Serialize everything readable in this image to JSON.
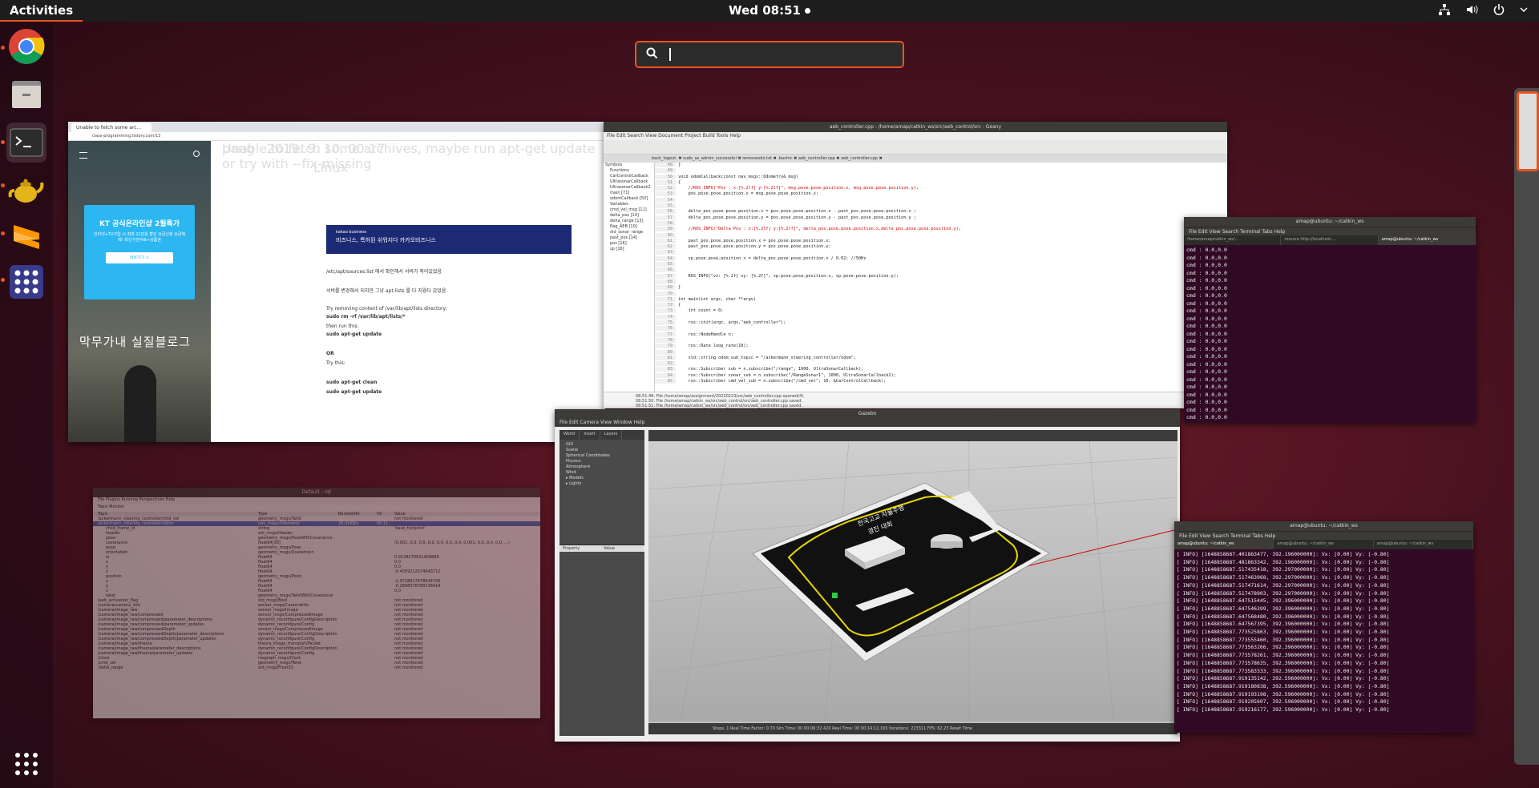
{
  "topbar": {
    "activities": "Activities",
    "clock": "Wed 08:51"
  },
  "dock": {
    "apps": [
      "chrome-icon",
      "files-icon",
      "terminal-icon",
      "teapot-icon",
      "sublime-icon",
      "apps-grid-icon"
    ],
    "show_apps": "show-apps-icon"
  },
  "search": {
    "placeholder": "",
    "value": ""
  },
  "browser": {
    "tab_title": "Unable to fetch some arc...",
    "url": "class-programming.tistory.com/13",
    "ad_heading": "KT 공식온라인샵 2월특가",
    "ad_sub": "인터넷+TV가입 시 최대 22만원 할인 요금신청 요금혜택! 최신가전무료+상품권",
    "ad_button": "바로가기 >",
    "blog_title": "막무가내 실질블로그",
    "category": "Linux",
    "post_title": "Unable to fetch some archives, maybe run apt-get update or try with --fix-missing",
    "meta": "pang · 2019. 9. 10. 00:17",
    "banner_brand": "kakao business",
    "banner_text": "비즈니스, 특허된 쉬워지다 카카오비즈니스",
    "lines": [
      "/etc/apt/sources.list 에서 확인해서 서버가 죽어있었음",
      "서버를 변경해서 되지만 그냥 apt.lists 를 다 지웠다 갔었음",
      "Try removing content of /var/lib/apt/lists directory:",
      "sudo rm -rf /var/lib/apt/lists/*",
      "then run this:",
      "sudo apt-get update",
      "OR",
      "Try this:",
      "sudo apt-get clean",
      "sudo apt-get update"
    ]
  },
  "geany": {
    "title": "aeb_controller.cpp - /home/amap/catkin_ws/src/aeb_control/src - Geany",
    "menu": "File  Edit  Search  View  Document  Project  Build  Tools  Help",
    "tabs": "back_logout.  ✖  sudo_as_admin_successful  ✖  removeodo.txt  ✖  .bashrc  ✖  aeb_controller.cpp  ✖  aeb_controller.cpp  ✖",
    "side_items": [
      "Symbols",
      "Functions",
      "CarControlCallback",
      "UltrasonarCallback",
      "UltrasonarCallback2",
      "main [71]",
      "odomCallback [50]",
      "Variables",
      "cmd_vel_msg [11]",
      "delta_pos [14]",
      "delta_range [13]",
      "flag_AEB [10]",
      "old_sonar_range",
      "past_pos [14]",
      "pos [16]",
      "sp [16]"
    ],
    "code": [
      [
        "48",
        "}"
      ],
      [
        "49",
        ""
      ],
      [
        "50",
        "void odomCallback(const nav_msgs::Odometry& msg)"
      ],
      [
        "51",
        "{"
      ],
      [
        "52",
        "    //ROS_INFO(\"Pos : x:[%.2lf] y:[%.2lf]\", msg.pose.pose.position.x, msg.pose.pose.position.y);"
      ],
      [
        "53",
        "    pos.pose.pose.position.x = msg.pose.pose.position.x;"
      ],
      [
        "54",
        ""
      ],
      [
        "55",
        ""
      ],
      [
        "56",
        "    delta_pos.pose.pose.position.x = pos.pose.pose.position.x - past_pos.pose.pose.position.x ;"
      ],
      [
        "57",
        "    delta_pos.pose.pose.position.y = pos.pose.pose.position.y - past_pos.pose.pose.position.y ;"
      ],
      [
        "58",
        ""
      ],
      [
        "59",
        "    //ROS_INFO(\"Delta Pos : x:[%.2lf] y:[%.2lf]\", delta_pos.pose.pose.position.x,delta_pos.pose.pose.position.y);"
      ],
      [
        "60",
        ""
      ],
      [
        "61",
        "    past_pos.pose.pose.position.x = pos.pose.pose.position.x;"
      ],
      [
        "62",
        "    past_pos.pose.pose.position.y = pos.pose.pose.position.y;"
      ],
      [
        "63",
        ""
      ],
      [
        "64",
        "    sp.pose.pose.position.x = delta_pos.pose.pose.position.x / 0.02; //50Hz"
      ],
      [
        "65",
        ""
      ],
      [
        "66",
        ""
      ],
      [
        "67",
        "    ROS_INFO(\"vx: [%.2f] vy: [%.2f]\", sp.pose.pose.position.x, sp.pose.pose.position.y);"
      ],
      [
        "68",
        ""
      ],
      [
        "69",
        "}"
      ],
      [
        "70",
        ""
      ],
      [
        "71",
        "int main(int argc, char **argv)"
      ],
      [
        "72",
        "{"
      ],
      [
        "73",
        "    int count = 0;"
      ],
      [
        "74",
        ""
      ],
      [
        "75",
        "    ros::init(argc, argv,\"aeb_controller\");"
      ],
      [
        "76",
        ""
      ],
      [
        "77",
        "    ros::NodeHandle n;"
      ],
      [
        "78",
        ""
      ],
      [
        "79",
        "    ros::Rate loop_rate(10);"
      ],
      [
        "80",
        ""
      ],
      [
        "81",
        "    std::string odom_sub_topic = \"/ackermann_steering_controller/odom\";"
      ],
      [
        "82",
        ""
      ],
      [
        "83",
        "    ros::Subscriber sub = n.subscribe(\"/range\", 1000, UltraSonarCallback);"
      ],
      [
        "84",
        "    ros::Subscriber sonar_sub = n.subscribe(\"/RangeSonar1\", 1000, UltraSonarCallback2);"
      ],
      [
        "85",
        "    ros::Subscriber cmd_vel_sub = n.subscribe(\"/cmd_vel\", 10, &CarControlCallback);"
      ]
    ],
    "status_lines": [
      "08:51:46: File /home/amap/assignment/20220223/src/aeb_controller.cpp opened(4).",
      "08:51:50: File /home/amap/catkin_ws/src/aeb_control/src/aeb_controller.cpp saved.",
      "08:51:51: File /home/amap/catkin_ws/src/aeb_control/src/aeb_controller.cpp saved."
    ],
    "status_label": "Status",
    "compiler_label": "Compiler"
  },
  "term1": {
    "title": "amap@ubuntu: ~/catkin_ws",
    "menu": "File  Edit  View  Search  Terminal  Tabs  Help",
    "tabs": [
      "/home/amap/catkin_ws/...",
      "roscore http://localhost:...",
      "amap@ubuntu: ~/catkin_ws"
    ],
    "line": "cmd : 0.0,0.0",
    "count": 26
  },
  "term2": {
    "title": "amap@ubuntu: ~/catkin_ws",
    "menu": "File  Edit  View  Search  Terminal  Tabs  Help",
    "tabs": [
      "amap@ubuntu: ~/catkin_ws",
      "amap@ubuntu: ~/catkin_ws",
      "amap@ubuntu: ~/catkin_ws"
    ],
    "lines": [
      "[ INFO] [1648858687.401863477, 392.196000000]: Vx: [0.00] Vy: [-0.80]",
      "[ INFO] [1648858687.481863342, 392.196000000]: Vx: [0.00] Vy: [-0.80]",
      "[ INFO] [1648858687.517435418, 392.297000000]: Vx: [0.00] Vy: [-0.80]",
      "[ INFO] [1648858687.517463968, 392.297000000]: Vx: [0.00] Vy: [-0.80]",
      "[ INFO] [1648858687.517471614, 392.297000000]: Vx: [0.00] Vy: [-0.80]",
      "[ INFO] [1648858687.517478903, 392.297000000]: Vx: [0.00] Vy: [-0.80]",
      "[ INFO] [1648858687.647515445, 392.396000000]: Vx: [0.00] Vy: [-0.80]",
      "[ INFO] [1648858687.647546399, 392.396000000]: Vx: [0.00] Vy: [-0.80]",
      "[ INFO] [1648858687.647568480, 392.396000000]: Vx: [0.00] Vy: [-0.80]",
      "[ INFO] [1648858687.647567395, 392.396000000]: Vx: [0.00] Vy: [-0.80]",
      "[ INFO] [1648858687.773525863, 392.396000000]: Vx: [0.00] Vy: [-0.80]",
      "[ INFO] [1648858687.773555460, 392.396000000]: Vx: [0.00] Vy: [-0.80]",
      "[ INFO] [1648858687.773563266, 392.396000000]: Vx: [0.00] Vy: [-0.80]",
      "[ INFO] [1648858687.773578261, 392.396000000]: Vx: [0.00] Vy: [-0.80]",
      "[ INFO] [1648858687.773578635, 392.396000000]: Vx: [0.00] Vy: [-0.80]",
      "[ INFO] [1648858687.773583333, 392.396000000]: Vx: [0.00] Vy: [-0.80]",
      "[ INFO] [1648858687.919135142, 392.596000000]: Vx: [0.00] Vy: [-0.80]",
      "[ INFO] [1648858687.919180838, 392.596000000]: Vx: [0.00] Vy: [-0.80]",
      "[ INFO] [1648858687.919193198, 392.596000000]: Vx: [0.00] Vy: [-0.80]",
      "[ INFO] [1648858687.919205607, 392.596000000]: Vx: [0.00] Vy: [-0.80]",
      "[ INFO] [1648858687.919216177, 392.596000000]: Vx: [0.00] Vy: [-0.80]"
    ]
  },
  "gazebo": {
    "title": "Gazebo",
    "menu": "File  Edit  Camera  View  Window  Help",
    "tabs": [
      "World",
      "Insert",
      "Layers"
    ],
    "tree": [
      "GUI",
      "Scene",
      "Spherical Coordinates",
      "Physics",
      "Atmosphere",
      "Wind",
      "▸ Models",
      "▸ Lights"
    ],
    "prop_headers": [
      "Property",
      "Value"
    ],
    "track_text": [
      "전국고교 자율주행",
      "경진 대회"
    ],
    "bottom": "Steps: 1  Real Time Factor: 0.70   Sim Time: 00 00:06:32.420   Real Time: 00 00:14:12.165   Iterations: 223311   FPS: 62.23   Reset Time"
  },
  "rqt": {
    "title": "Default - rqt",
    "menu": "File  Plugins  Running  Perspectives  Help",
    "panel": "Topic Monitor",
    "headers": [
      "Topic",
      "Type",
      "Bandwidth",
      "Hz",
      "Value"
    ],
    "rows": [
      [
        "/ackermann_steering_controller/cmd_vel",
        "geometry_msgs/Twist",
        "",
        "",
        "not monitored"
      ],
      [
        "/ackermann_steering_controller/odom",
        "nav_msgs/Odometry",
        "28.01KB/s",
        "50.11",
        ""
      ],
      [
        "child_frame_id",
        "string",
        "",
        "",
        "'base_footprint'"
      ],
      [
        "header",
        "std_msgs/Header",
        "",
        "",
        ""
      ],
      [
        "pose",
        "geometry_msgs/PoseWithCovariance",
        "",
        "",
        ""
      ],
      [
        "covariance",
        "float64[36]",
        "",
        "",
        "(0.001, 0.0, 0.0, 0.0, 0.0, 0.0, 0.0, 0.001, 0.0, 0.0, 0.0, ...)"
      ],
      [
        "pose",
        "geometry_msgs/Pose",
        "",
        "",
        ""
      ],
      [
        "orientation",
        "geometry_msgs/Quaternion",
        "",
        "",
        ""
      ],
      [
        "w",
        "float64",
        "",
        "",
        "0.9138278831409888"
      ],
      [
        "x",
        "float64",
        "",
        "",
        "0.0"
      ],
      [
        "y",
        "float64",
        "",
        "",
        "0.0"
      ],
      [
        "z",
        "float64",
        "",
        "",
        "-0.4059212574643712"
      ],
      [
        "position",
        "geometry_msgs/Point",
        "",
        "",
        ""
      ],
      [
        "x",
        "float64",
        "",
        "",
        "-1.9728817678544706"
      ],
      [
        "y",
        "float64",
        "",
        "",
        "-0.2898378780136914"
      ],
      [
        "z",
        "float64",
        "",
        "",
        "0.0"
      ],
      [
        "twist",
        "geometry_msgs/TwistWithCovariance",
        "",
        "",
        ""
      ],
      [
        "/aeb_activation_flag",
        "std_msgs/Bool",
        "",
        "",
        "not monitored"
      ],
      [
        "/camera/camera_info",
        "sensor_msgs/CameraInfo",
        "",
        "",
        "not monitored"
      ],
      [
        "/camera/image_raw",
        "sensor_msgs/Image",
        "",
        "",
        "not monitored"
      ],
      [
        "/camera/image_raw/compressed",
        "sensor_msgs/CompressedImage",
        "",
        "",
        "not monitored"
      ],
      [
        "/camera/image_raw/compressed/parameter_descriptions",
        "dynamic_reconfigure/ConfigDescription",
        "",
        "",
        "not monitored"
      ],
      [
        "/camera/image_raw/compressed/parameter_updates",
        "dynamic_reconfigure/Config",
        "",
        "",
        "not monitored"
      ],
      [
        "/camera/image_raw/compressedDepth",
        "sensor_msgs/CompressedImage",
        "",
        "",
        "not monitored"
      ],
      [
        "/camera/image_raw/compressedDepth/parameter_descriptions",
        "dynamic_reconfigure/ConfigDescription",
        "",
        "",
        "not monitored"
      ],
      [
        "/camera/image_raw/compressedDepth/parameter_updates",
        "dynamic_reconfigure/Config",
        "",
        "",
        "not monitored"
      ],
      [
        "/camera/image_raw/theora",
        "theora_image_transport/Packet",
        "",
        "",
        "not monitored"
      ],
      [
        "/camera/image_raw/theora/parameter_descriptions",
        "dynamic_reconfigure/ConfigDescription",
        "",
        "",
        "not monitored"
      ],
      [
        "/camera/image_raw/theora/parameter_updates",
        "dynamic_reconfigure/Config",
        "",
        "",
        "not monitored"
      ],
      [
        "/clock",
        "rosgraph_msgs/Clock",
        "",
        "",
        "not monitored"
      ],
      [
        "/cmd_vel",
        "geometry_msgs/Twist",
        "",
        "",
        "not monitored"
      ],
      [
        "/delta_range",
        "std_msgs/Float32",
        "",
        "",
        "not monitored"
      ]
    ]
  }
}
